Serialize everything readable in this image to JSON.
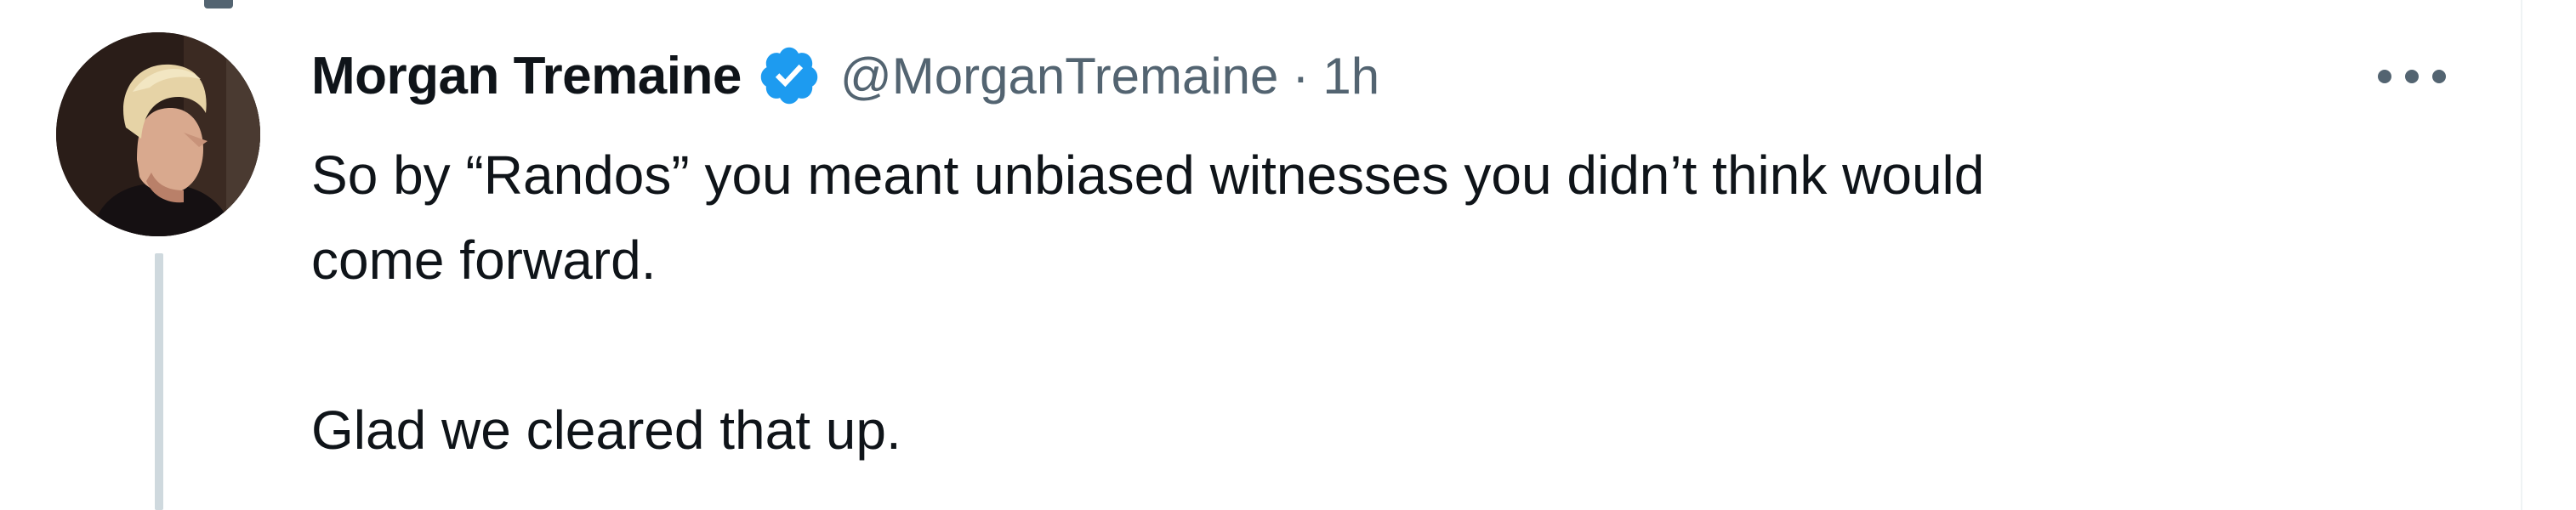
{
  "tweet": {
    "display_name": "Morgan Tremaine",
    "handle": "@MorganTremaine",
    "separator": "·",
    "timestamp": "1h",
    "verified": true,
    "body_line_1": "So by “Randos” you meant unbiased witnesses you didn’t think would",
    "body_line_2": "come forward.",
    "body_line_3": "Glad we cleared that up."
  },
  "colors": {
    "verified_blue": "#1d9bf0",
    "secondary_text": "#536471",
    "primary_text": "#0f1419",
    "thread_line": "#cfd9de"
  },
  "icons": {
    "verified": "verified-badge-icon",
    "more": "more-options-icon"
  }
}
